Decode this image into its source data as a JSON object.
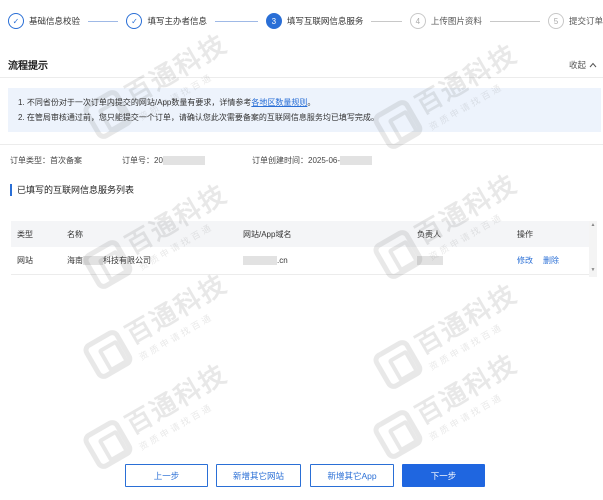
{
  "stepper": {
    "steps": [
      {
        "label": "基础信息校验",
        "state": "done",
        "num": "✓"
      },
      {
        "label": "填写主办者信息",
        "state": "done",
        "num": "✓"
      },
      {
        "label": "填写互联网信息服务",
        "state": "active",
        "num": "3"
      },
      {
        "label": "上传图片资料",
        "state": "todo",
        "num": "4"
      },
      {
        "label": "提交订单",
        "state": "todo",
        "num": "5"
      }
    ]
  },
  "process": {
    "title": "流程提示",
    "collapse_label": "收起"
  },
  "notice": {
    "line1_prefix": "1. 不同省份对于一次订单内提交的网站/App数量有要求，详情参考",
    "line1_link": "各地区数量规则",
    "line1_suffix": "。",
    "line2": "2. 在管局审核通过前，您只能提交一个订单，请确认您此次需要备案的互联网信息服务均已填写完成。"
  },
  "order": {
    "type_label": "订单类型：",
    "type_value": "首次备案",
    "no_label": "订单号：",
    "no_value": "20",
    "time_label": "订单创建时间：",
    "time_value": "2025-06-"
  },
  "list": {
    "title": "已填写的互联网信息服务列表",
    "headers": {
      "type": "类型",
      "name": "名称",
      "domain": "网站/App域名",
      "owner": "负责人",
      "actions": "操作"
    },
    "rows": [
      {
        "type": "网站",
        "name_prefix": "海南",
        "name_suffix": "科技有限公司",
        "domain_suffix": ".cn",
        "edit": "修改",
        "delete": "删除"
      }
    ]
  },
  "watermark": {
    "text": "百通科技",
    "sub": "资质申请找百通"
  },
  "buttons": {
    "prev": "上一步",
    "add_site": "新增其它网站",
    "add_app": "新增其它App",
    "next": "下一步"
  },
  "colors": {
    "primary": "#1f66e0",
    "notice_bg": "#edf3fc"
  }
}
